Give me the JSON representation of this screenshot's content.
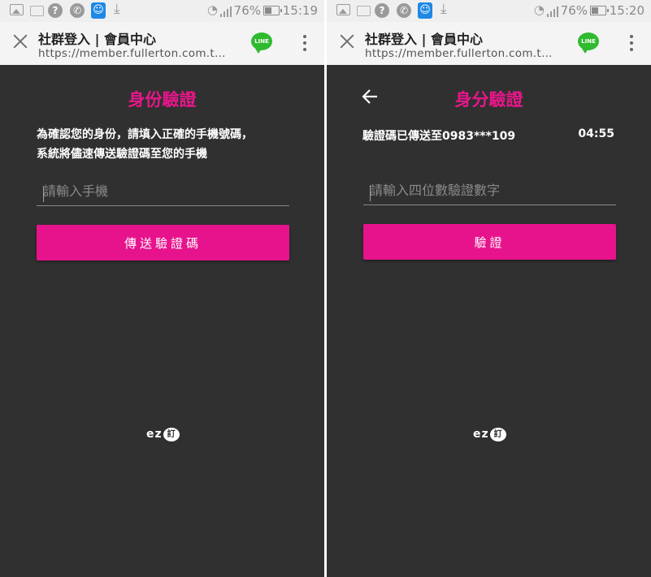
{
  "left": {
    "statusbar": {
      "help_glyph": "?",
      "battery_pct": "76%",
      "time": "15:19"
    },
    "browser": {
      "title": "社群登入 | 會員中心",
      "url": "https://member.fullerton.com.t…",
      "line_label": "LINE"
    },
    "heading": "身份驗證",
    "description_line1": "為確認您的身份，請填入正確的手機號碼，",
    "description_line2": "系統將儘速傳送驗證碼至您的手機",
    "phone_input": {
      "placeholder": "請輸入手機",
      "value": ""
    },
    "send_button_label": "傳送驗證碼",
    "logo": {
      "text": "ez",
      "bubble": "訂"
    }
  },
  "right": {
    "statusbar": {
      "help_glyph": "?",
      "battery_pct": "76%",
      "time": "15:20"
    },
    "browser": {
      "title": "社群登入 | 會員中心",
      "url": "https://member.fullerton.com.t…",
      "line_label": "LINE"
    },
    "heading": "身分驗證",
    "sent_message": "驗證碼已傳送至0983***109",
    "countdown": "04:55",
    "code_input": {
      "placeholder": "請輸入四位數驗證數字",
      "value": ""
    },
    "verify_button_label": "驗證",
    "logo": {
      "text": "ez",
      "bubble": "訂"
    }
  },
  "colors": {
    "accent": "#e6138c",
    "heading": "#e8168a",
    "background": "#303030",
    "line_green": "#2fba2f"
  },
  "icons": [
    "image-icon",
    "message-icon",
    "help-icon",
    "phone-icon",
    "contact-icon",
    "download-icon",
    "wifi-icon",
    "signal-icon",
    "battery-icon",
    "close-icon",
    "line-icon",
    "more-menu-icon",
    "back-arrow-icon"
  ]
}
